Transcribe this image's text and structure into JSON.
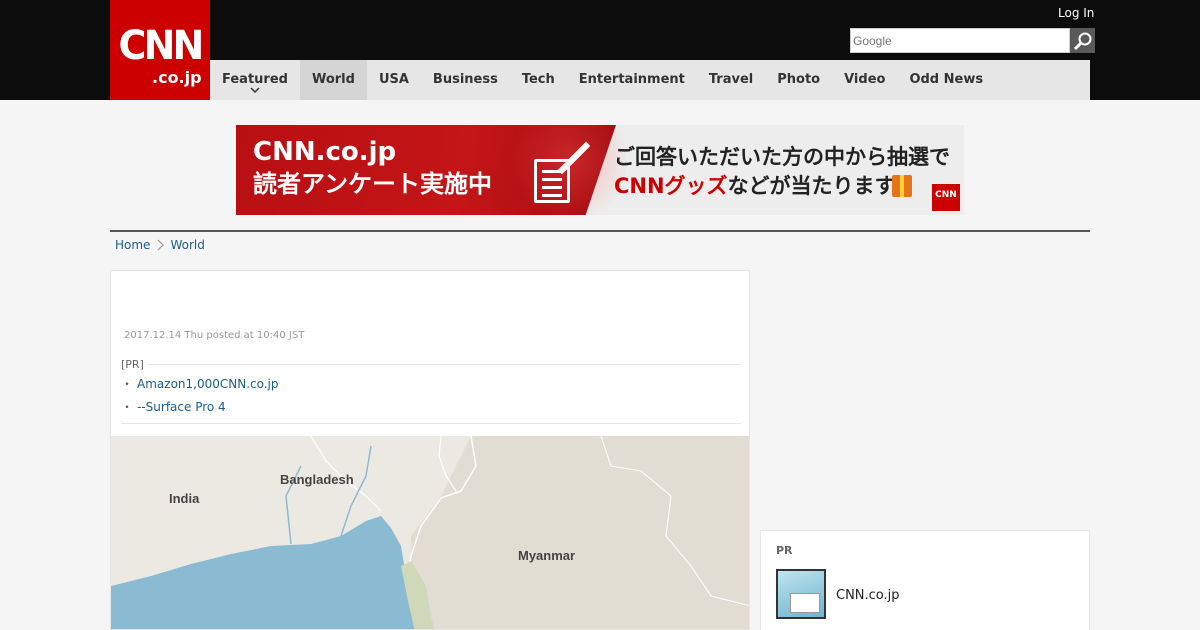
{
  "header": {
    "logo_main": "CNN",
    "logo_sub": ".co.jp",
    "login": "Log In",
    "search_placeholder": "Google"
  },
  "nav": {
    "items": [
      {
        "label": "Featured",
        "active": false,
        "has_dropdown": true
      },
      {
        "label": "World",
        "active": true
      },
      {
        "label": "USA"
      },
      {
        "label": "Business"
      },
      {
        "label": "Tech"
      },
      {
        "label": "Entertainment"
      },
      {
        "label": "Travel"
      },
      {
        "label": "Photo"
      },
      {
        "label": "Video"
      },
      {
        "label": "Odd News"
      }
    ]
  },
  "banner": {
    "line1": "CNN.co.jp",
    "line2": "読者アンケート実施中",
    "line3": "ご回答いただいた方の中から抽選で",
    "line4_highlight": "CNNグッズ",
    "line4_rest": "などが当たります",
    "badge": "CNN"
  },
  "breadcrumb": {
    "home": "Home",
    "current": "World"
  },
  "article": {
    "date": "2017.12.14 Thu posted at 10:40 JST",
    "pr_label": "[PR]",
    "pr_links": [
      "Amazon1,000CNN.co.jp",
      "--Surface Pro 4"
    ],
    "map_labels": {
      "india": "India",
      "bangladesh": "Bangladesh",
      "myanmar": "Myanmar"
    }
  },
  "sidebar": {
    "pr_label": "PR",
    "pr_title": "CNN.co.jp"
  },
  "colors": {
    "brand_red": "#cc0000",
    "header_black": "#0c0c0c",
    "link_blue": "#1a5d8f",
    "nav_bg": "#e6e6e6",
    "water": "#8bbbd3"
  }
}
